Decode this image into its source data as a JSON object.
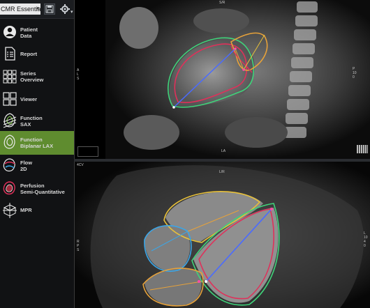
{
  "toolbar": {
    "protocol": "CMR Essentials",
    "save_icon": "save-icon",
    "gear_icon": "gear-icon"
  },
  "sidebar": {
    "items": [
      {
        "label": "Patient\nData",
        "icon": "patient-icon",
        "active": false
      },
      {
        "label": "Report",
        "icon": "report-icon",
        "active": false
      },
      {
        "label": "Series\nOverview",
        "icon": "series-overview-icon",
        "active": false
      },
      {
        "label": "Viewer",
        "icon": "viewer-icon",
        "active": false
      },
      {
        "label": "Function\nSAX",
        "icon": "function-sax-icon",
        "active": false
      },
      {
        "label": "Function\nBiplanar LAX",
        "icon": "function-lax-icon",
        "active": true
      },
      {
        "label": "Flow\n2D",
        "icon": "flow-icon",
        "active": false
      },
      {
        "label": "Perfusion\nSemi-Quantitative",
        "icon": "perfusion-icon",
        "active": false
      },
      {
        "label": "MPR",
        "icon": "mpr-icon",
        "active": false
      }
    ]
  },
  "viewports": {
    "top": {
      "orientation_top": "S/R",
      "orientation_left": "A\nL\nS",
      "orientation_bottom": "LA",
      "orientation_right": "P\n10\n0"
    },
    "bottom": {
      "label": "4CV",
      "orientation_top": "L/R",
      "orientation_left": "R\nP\nS",
      "orientation_right": "L\n10\n4\n0"
    }
  },
  "colors": {
    "accent_active": "#5f8c2f",
    "contour_green": "#3fd37a",
    "contour_red": "#e0305a",
    "contour_orange": "#e7a23a",
    "contour_yellow": "#e8c13a",
    "contour_blue": "#3aa6e8",
    "axis_blue": "#4a6bff"
  }
}
